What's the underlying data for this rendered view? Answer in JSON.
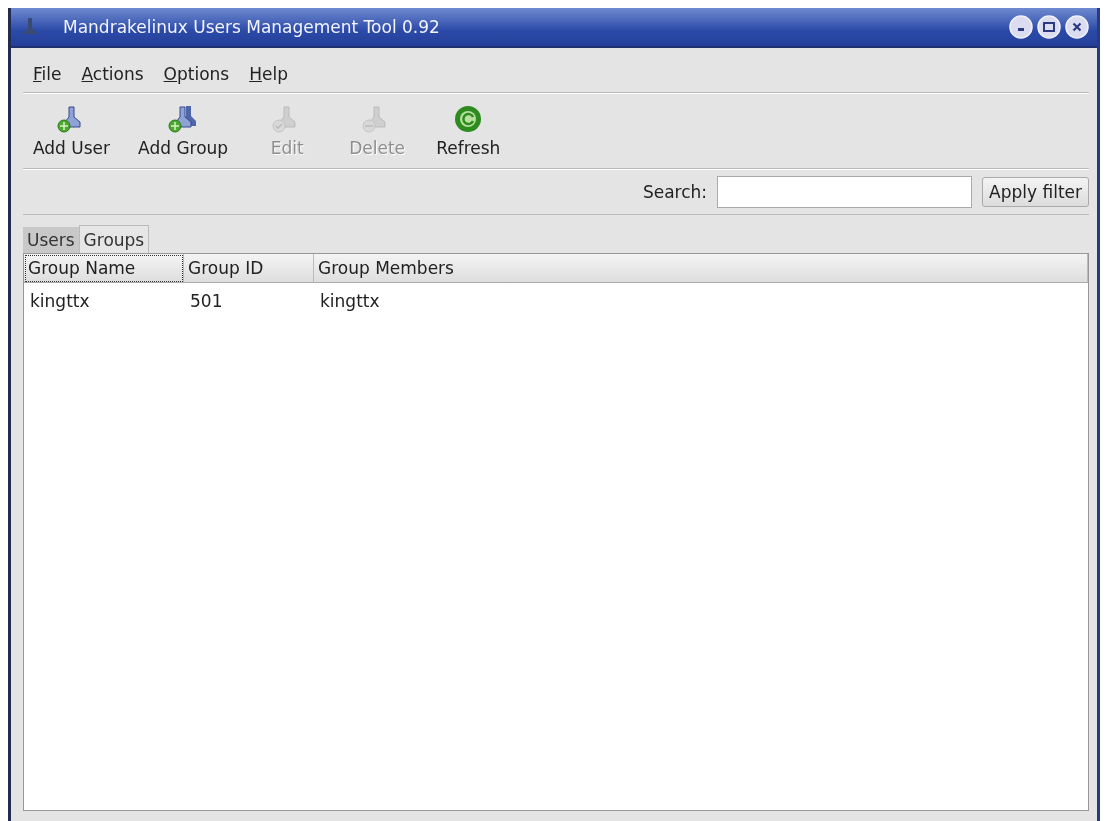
{
  "window": {
    "title": "Mandrakelinux Users Management Tool 0.92"
  },
  "menu": [
    {
      "accel": "F",
      "rest": "ile"
    },
    {
      "accel": "A",
      "rest": "ctions"
    },
    {
      "accel": "O",
      "rest": "ptions"
    },
    {
      "accel": "H",
      "rest": "elp"
    }
  ],
  "toolbar": [
    {
      "kind": "add-user",
      "label": "Add User",
      "disabled": false
    },
    {
      "kind": "add-group",
      "label": "Add Group",
      "disabled": false
    },
    {
      "kind": "edit",
      "label": "Edit",
      "disabled": true
    },
    {
      "kind": "delete",
      "label": "Delete",
      "disabled": true
    },
    {
      "kind": "refresh",
      "label": "Refresh",
      "disabled": false
    }
  ],
  "search": {
    "label": "Search:",
    "button": "Apply filter"
  },
  "tabs": [
    {
      "label": "Users",
      "selected": false
    },
    {
      "label": "Groups",
      "selected": true
    }
  ],
  "table": {
    "columns": [
      {
        "label": "Group Name",
        "focused": true
      },
      {
        "label": "Group ID",
        "focused": false
      },
      {
        "label": "Group Members",
        "focused": false
      }
    ],
    "rows": [
      [
        "kingttx",
        "501",
        "kingttx"
      ]
    ]
  }
}
